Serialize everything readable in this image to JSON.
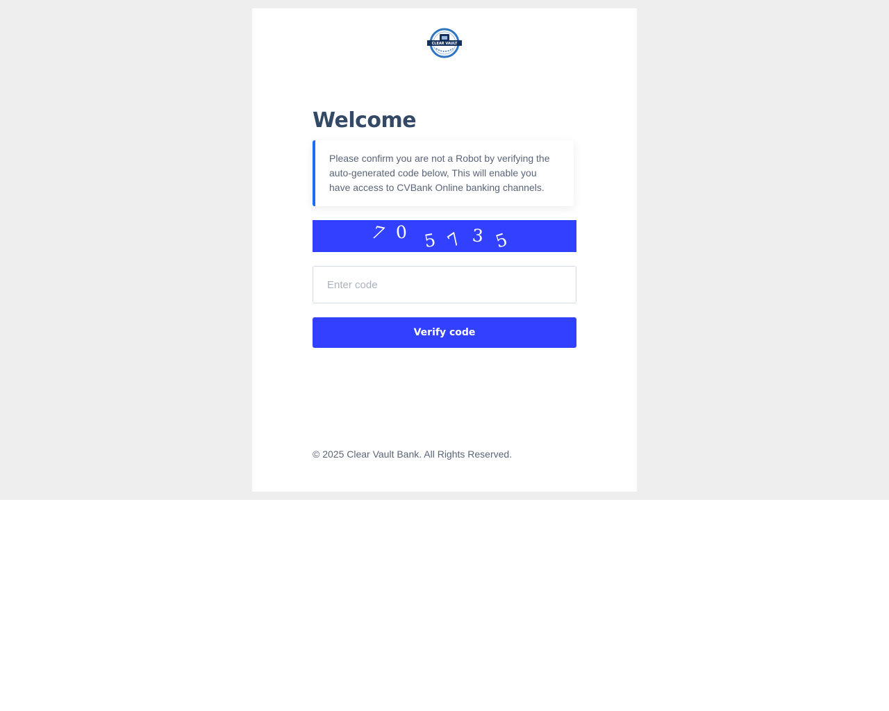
{
  "brand": {
    "logo_icon": "clear-vault-bank-seal",
    "logo_text": "CLEAR VAULT",
    "colors": {
      "primary": "#3241ff",
      "accent": "#1a6ef5",
      "heading": "#344966",
      "logo_navy": "#15305c",
      "logo_blue": "#2f74c0"
    }
  },
  "page": {
    "title": "Welcome",
    "notice": "Please confirm you are not a Robot by verifying the auto-generated code below, This will enable you have access to CVBank Online banking channels."
  },
  "captcha": {
    "characters": [
      "7",
      "0",
      "5",
      "7",
      "3",
      "5"
    ]
  },
  "form": {
    "code_placeholder": "Enter code",
    "code_value": "",
    "verify_label": "Verify code"
  },
  "footer": {
    "copyright": "© 2025 Clear Vault Bank. All Rights Reserved."
  }
}
